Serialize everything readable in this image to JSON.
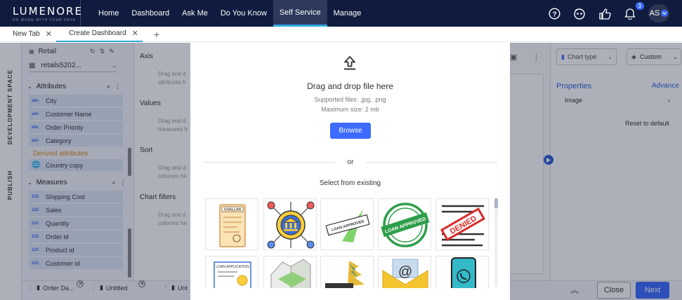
{
  "app": {
    "logo": "LUMENORE",
    "logo_sub": "DO MORE WITH YOUR DATA"
  },
  "nav": [
    {
      "label": "Home"
    },
    {
      "label": "Dashboard"
    },
    {
      "label": "Ask Me"
    },
    {
      "label": "Do You Know"
    },
    {
      "label": "Self Service",
      "active": true
    },
    {
      "label": "Manage"
    }
  ],
  "header_right": {
    "notification_count": "3",
    "avatar_initials": "AS"
  },
  "tabs": [
    {
      "label": "New Tab"
    },
    {
      "label": "Create Dashboard",
      "active": true
    }
  ],
  "side_labels": {
    "dev": "DEVELOPMENT SPACE",
    "publish": "PUBLISH"
  },
  "left_panel": {
    "dataset": "Retail",
    "table": "retails5202...",
    "attributes_title": "Attributes",
    "attributes": [
      {
        "type": "abc",
        "name": "City"
      },
      {
        "type": "abc",
        "name": "Customer Name"
      },
      {
        "type": "abc",
        "name": "Order Priority"
      },
      {
        "type": "abc",
        "name": "Category"
      }
    ],
    "derived_title": "Derived attributes",
    "derived": [
      {
        "type": "geo",
        "name": "Country copy"
      }
    ],
    "measures_title": "Measures",
    "measures": [
      {
        "type": "123",
        "name": "Shipping Cost"
      },
      {
        "type": "123",
        "name": "Sales"
      },
      {
        "type": "123",
        "name": "Quantity"
      },
      {
        "type": "123",
        "name": "Order id"
      },
      {
        "type": "123",
        "name": "Product id"
      },
      {
        "type": "123",
        "name": "Customer id"
      }
    ]
  },
  "middle": {
    "axis": "Axis",
    "axis_desc": "Drag and d attributes h",
    "values": "Values",
    "values_desc": "Drag and d measures h",
    "sort": "Sort",
    "sort_desc": "Drag and d columns he",
    "filters": "Chart filters",
    "filters_desc": "Drag and d columns he"
  },
  "right_panel": {
    "chart_type": "Chart type",
    "custom": "Custom",
    "properties": "Properties",
    "advanced": "Advance",
    "image": "Image",
    "reset": "Reset to default"
  },
  "bottom_tabs": [
    "Order Da...",
    "Untitled",
    "Unt"
  ],
  "bottom_buttons": {
    "close": "Close",
    "next": "Next"
  },
  "modal": {
    "drag_text": "Drag and drop file here",
    "supported": "Supported files: .jpg, .png",
    "max_size": "Maximum size: 2 mb",
    "browse": "Browse",
    "or": "or",
    "select_existing": "Select from existing",
    "thumb_texts": {
      "challan": "CHALLAN",
      "loan_approved": "LOAN APPROVED",
      "denied": "DENIED",
      "loan_application": "LOAN APPLICATION",
      "email_at": "@"
    }
  },
  "colors": {
    "topbar": "#0f1c3f",
    "accent": "#2ea7e0",
    "primary_button": "#3d6bff"
  }
}
